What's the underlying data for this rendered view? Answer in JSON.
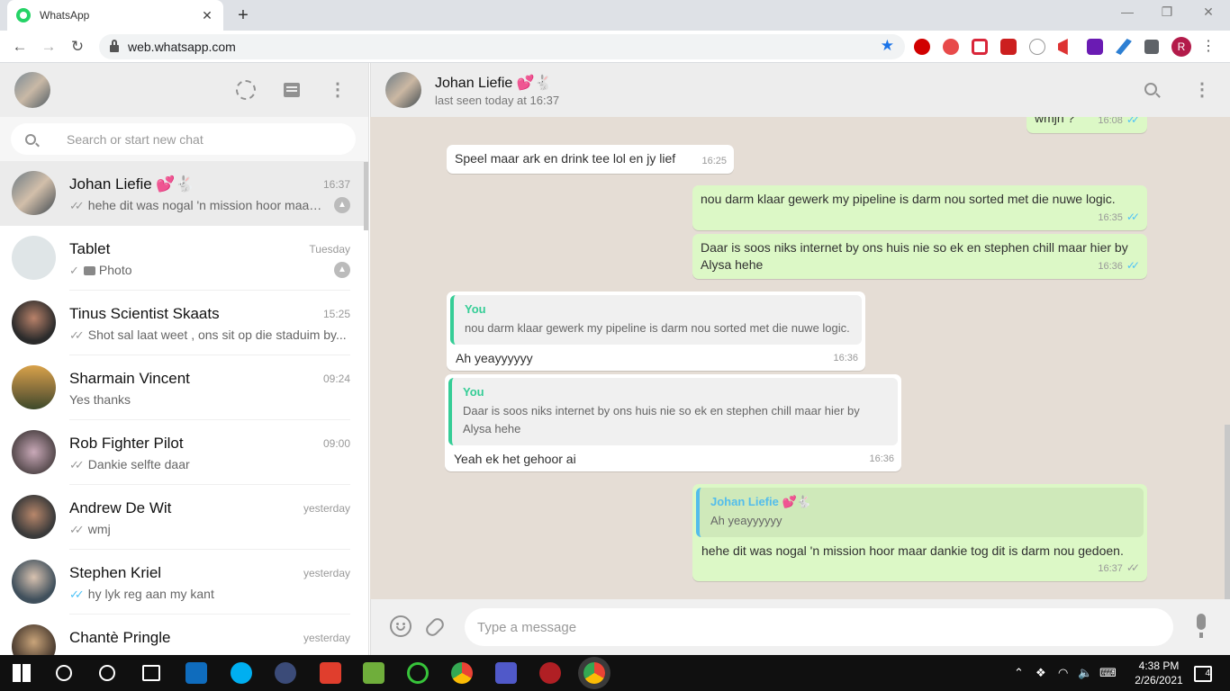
{
  "browser": {
    "tab_title": "WhatsApp",
    "tab_close": "✕",
    "new_tab": "+",
    "url": "web.whatsapp.com",
    "profile_initial": "R"
  },
  "sidebar": {
    "search_placeholder": "Search or start new chat",
    "chats": [
      {
        "name": "Johan Liefie 💕🐇",
        "time": "16:37",
        "tick": "✓✓",
        "tick_color": "gray",
        "preview": "hehe dit was nogal 'n mission hoor maar dankie tog dit is darm nou gedoen.",
        "pinned": true,
        "active": true
      },
      {
        "name": "Tablet",
        "time": "Tuesday",
        "tick": "✓",
        "tick_color": "gray",
        "preview": "Photo",
        "pinned": true,
        "photo": true
      },
      {
        "name": "Tinus Scientist Skaats",
        "time": "15:25",
        "tick": "✓✓",
        "tick_color": "gray",
        "preview": "Shot sal laat weet , ons sit op die staduim by..."
      },
      {
        "name": "Sharmain Vincent",
        "time": "09:24",
        "tick": "",
        "preview": "Yes thanks"
      },
      {
        "name": "Rob Fighter Pilot",
        "time": "09:00",
        "tick": "✓✓",
        "tick_color": "gray",
        "preview": "Dankie selfte daar"
      },
      {
        "name": "Andrew De Wit",
        "time": "yesterday",
        "tick": "✓✓",
        "tick_color": "gray",
        "preview": "wmj"
      },
      {
        "name": "Stephen Kriel",
        "time": "yesterday",
        "tick": "✓✓",
        "tick_color": "blue",
        "preview": "hy lyk reg aan my kant"
      },
      {
        "name": "Chantè Pringle",
        "time": "yesterday",
        "tick": "",
        "preview": ""
      }
    ]
  },
  "conversation": {
    "contact_name": "Johan Liefie 💕🐇",
    "contact_status": "last seen today at 16:37",
    "input_placeholder": "Type a message",
    "messages": [
      {
        "dir": "out",
        "text": "wmjh ?",
        "time": "16:08",
        "tick": "✓✓"
      },
      {
        "dir": "in",
        "text": "Speel maar ark en drink tee lol en jy lief",
        "time": "16:25"
      },
      {
        "dir": "out",
        "text": "nou darm klaar gewerk my pipeline is darm nou sorted met die nuwe logic.",
        "time": "16:35",
        "tick": "✓✓"
      },
      {
        "dir": "out",
        "text": "Daar is soos niks internet by ons huis nie so ek en stephen chill maar hier by Alysa hehe",
        "time": "16:36",
        "tick": "✓✓"
      },
      {
        "dir": "in",
        "quote_name": "You",
        "quote_text": "nou darm klaar gewerk my pipeline is darm nou sorted met die nuwe logic.",
        "text": "Ah yeayyyyyy",
        "time": "16:36"
      },
      {
        "dir": "in",
        "quote_name": "You",
        "quote_text": "Daar is soos niks internet by ons huis nie so ek en stephen chill maar hier by Alysa hehe",
        "text": "Yeah ek het gehoor ai",
        "time": "16:36"
      },
      {
        "dir": "out",
        "quote_name": "Johan Liefie 💕🐇",
        "quote_text": "Ah yeayyyyyy",
        "text": "hehe dit was nogal 'n mission hoor maar dankie tog dit is darm nou gedoen.",
        "time": "16:37",
        "tick": "✓✓"
      }
    ]
  },
  "taskbar": {
    "time": "4:38 PM",
    "date": "2/26/2021",
    "notifications": "4"
  },
  "colors": {
    "accent_green": "#25d366",
    "outgoing_bubble": "#dcf8c6",
    "chat_bg": "#e5ddd5",
    "read_tick": "#4fc3f7"
  }
}
